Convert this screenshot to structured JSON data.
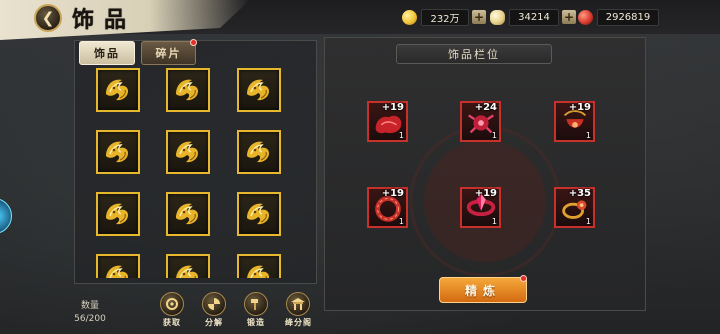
{
  "header": {
    "title": "饰品",
    "resources": [
      {
        "icon": "gold-coin-icon",
        "value": "232万",
        "color": "#f2c437"
      },
      {
        "icon": "silver-ingot-icon",
        "value": "34214",
        "color": "#e8d28a"
      },
      {
        "icon": "red-crystal-icon",
        "value": "2926819",
        "color": "#d83a2e"
      }
    ]
  },
  "tabs": [
    {
      "label": "饰品",
      "active": true
    },
    {
      "label": "碎片",
      "active": false,
      "has_notification": true
    }
  ],
  "inventory": {
    "item_icon": "gold-fox-accessory-icon",
    "rows": 4,
    "cols": 3,
    "count_label": "数量",
    "count_value": "56/200"
  },
  "actions": [
    {
      "label": "获取",
      "icon": "obtain-icon"
    },
    {
      "label": "分解",
      "icon": "decompose-icon"
    },
    {
      "label": "锻造",
      "icon": "hammer-icon"
    },
    {
      "label": "绛分阁",
      "icon": "pavilion-icon"
    }
  ],
  "slots_panel": {
    "title": "饰品栏位",
    "slots": [
      {
        "level": "+19",
        "quantity": "1",
        "icon": "red-mask-icon"
      },
      {
        "level": "+24",
        "quantity": "1",
        "icon": "red-crab-icon"
      },
      {
        "level": "+19",
        "quantity": "1",
        "icon": "red-pendant-icon"
      },
      {
        "level": "+19",
        "quantity": "1",
        "icon": "red-bracelet-icon"
      },
      {
        "level": "+19",
        "quantity": "1",
        "icon": "red-ruby-ring-icon"
      },
      {
        "level": "+35",
        "quantity": "1",
        "icon": "gold-ring-icon"
      }
    ],
    "refine_label": "精炼",
    "refine_has_notification": true
  }
}
